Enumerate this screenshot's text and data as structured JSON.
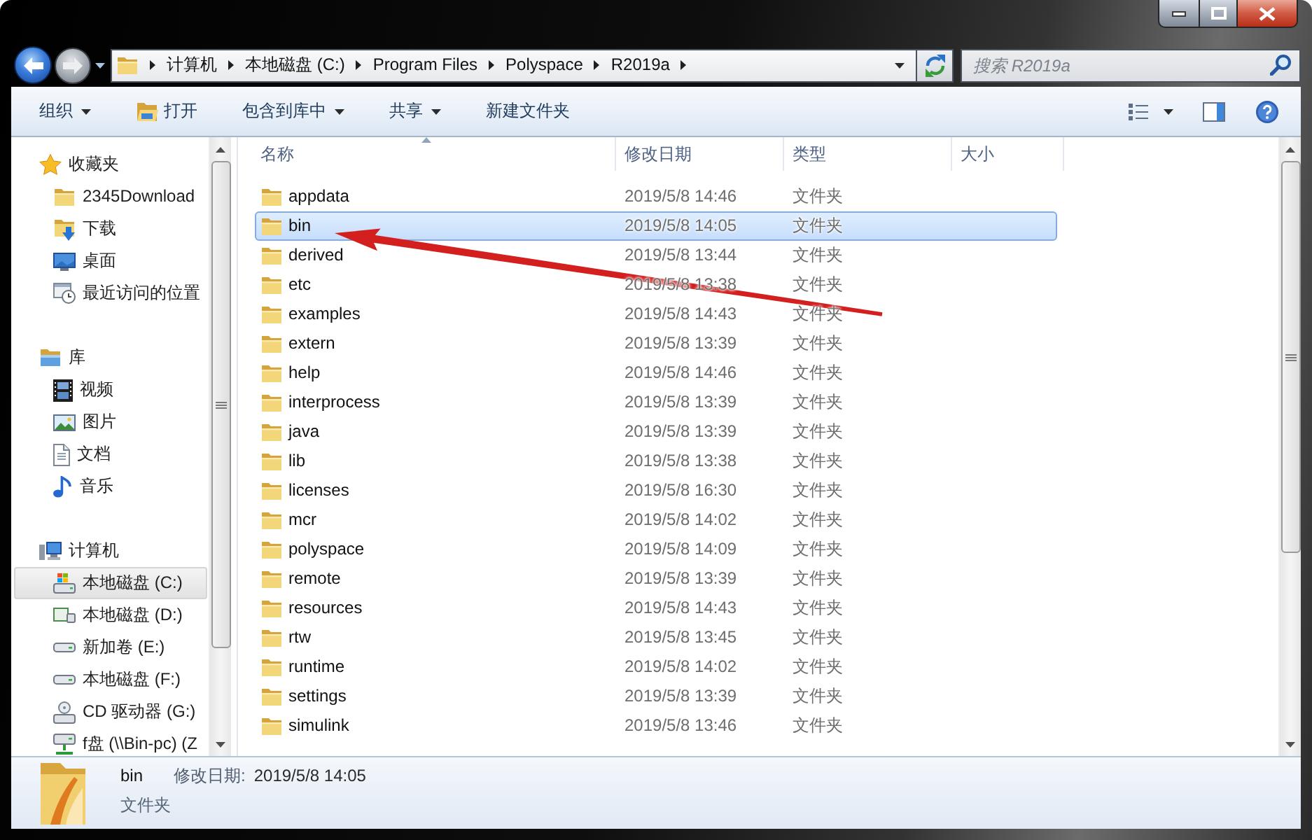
{
  "address_bar": {
    "crumbs": [
      "计算机",
      "本地磁盘 (C:)",
      "Program Files",
      "Polyspace",
      "R2019a"
    ]
  },
  "search": {
    "placeholder": "搜索 R2019a"
  },
  "toolbar": {
    "items": [
      {
        "label": "组织",
        "kind": "menu"
      },
      {
        "label": "打开",
        "kind": "open"
      },
      {
        "label": "包含到库中",
        "kind": "menu"
      },
      {
        "label": "共享",
        "kind": "menu"
      },
      {
        "label": "新建文件夹",
        "kind": "plain"
      }
    ]
  },
  "sidebar": {
    "groups": [
      {
        "label": "收藏夹",
        "kind": "favorites",
        "selected": false,
        "children": [
          {
            "label": "2345Download",
            "kind": "folder",
            "selected": false
          },
          {
            "label": "下载",
            "kind": "downloads",
            "selected": false
          },
          {
            "label": "桌面",
            "kind": "desktop",
            "selected": false
          },
          {
            "label": "最近访问的位置",
            "kind": "recent",
            "selected": false
          }
        ]
      },
      {
        "label": "库",
        "kind": "library",
        "selected": false,
        "children": [
          {
            "label": "视频",
            "kind": "video",
            "selected": false
          },
          {
            "label": "图片",
            "kind": "pictures",
            "selected": false
          },
          {
            "label": "文档",
            "kind": "documents",
            "selected": false
          },
          {
            "label": "音乐",
            "kind": "music",
            "selected": false
          }
        ]
      },
      {
        "label": "计算机",
        "kind": "computer",
        "selected": false,
        "children": [
          {
            "label": "本地磁盘 (C:)",
            "kind": "system_drive",
            "selected": true
          },
          {
            "label": "本地磁盘 (D:)",
            "kind": "drive_d",
            "selected": false
          },
          {
            "label": "新加卷 (E:)",
            "kind": "drive",
            "selected": false
          },
          {
            "label": "本地磁盘 (F:)",
            "kind": "drive",
            "selected": false
          },
          {
            "label": "CD 驱动器 (G:)",
            "kind": "cd",
            "selected": false
          },
          {
            "label": "f盘 (\\\\Bin-pc) (Z",
            "kind": "network",
            "selected": false
          }
        ]
      }
    ]
  },
  "columns": [
    {
      "label": "名称",
      "sorted": true
    },
    {
      "label": "修改日期",
      "sorted": false
    },
    {
      "label": "类型",
      "sorted": false
    },
    {
      "label": "大小",
      "sorted": false
    }
  ],
  "files": [
    {
      "name": "appdata",
      "modified": "2019/5/8 14:46",
      "type": "文件夹",
      "selected": false
    },
    {
      "name": "bin",
      "modified": "2019/5/8 14:05",
      "type": "文件夹",
      "selected": true
    },
    {
      "name": "derived",
      "modified": "2019/5/8 13:44",
      "type": "文件夹",
      "selected": false
    },
    {
      "name": "etc",
      "modified": "2019/5/8 13:38",
      "type": "文件夹",
      "selected": false
    },
    {
      "name": "examples",
      "modified": "2019/5/8 14:43",
      "type": "文件夹",
      "selected": false
    },
    {
      "name": "extern",
      "modified": "2019/5/8 13:39",
      "type": "文件夹",
      "selected": false
    },
    {
      "name": "help",
      "modified": "2019/5/8 14:46",
      "type": "文件夹",
      "selected": false
    },
    {
      "name": "interprocess",
      "modified": "2019/5/8 13:39",
      "type": "文件夹",
      "selected": false
    },
    {
      "name": "java",
      "modified": "2019/5/8 13:39",
      "type": "文件夹",
      "selected": false
    },
    {
      "name": "lib",
      "modified": "2019/5/8 13:38",
      "type": "文件夹",
      "selected": false
    },
    {
      "name": "licenses",
      "modified": "2019/5/8 16:30",
      "type": "文件夹",
      "selected": false
    },
    {
      "name": "mcr",
      "modified": "2019/5/8 14:02",
      "type": "文件夹",
      "selected": false
    },
    {
      "name": "polyspace",
      "modified": "2019/5/8 14:09",
      "type": "文件夹",
      "selected": false
    },
    {
      "name": "remote",
      "modified": "2019/5/8 13:39",
      "type": "文件夹",
      "selected": false
    },
    {
      "name": "resources",
      "modified": "2019/5/8 14:43",
      "type": "文件夹",
      "selected": false
    },
    {
      "name": "rtw",
      "modified": "2019/5/8 13:45",
      "type": "文件夹",
      "selected": false
    },
    {
      "name": "runtime",
      "modified": "2019/5/8 14:02",
      "type": "文件夹",
      "selected": false
    },
    {
      "name": "settings",
      "modified": "2019/5/8 13:39",
      "type": "文件夹",
      "selected": false
    },
    {
      "name": "simulink",
      "modified": "2019/5/8 13:46",
      "type": "文件夹",
      "selected": false
    }
  ],
  "details": {
    "name": "bin",
    "modified_label": "修改日期:",
    "modified": "2019/5/8 14:05",
    "type": "文件夹"
  }
}
